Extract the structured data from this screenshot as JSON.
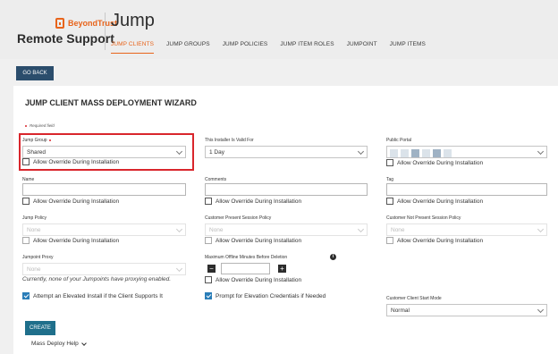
{
  "brand": {
    "logo_text": "BeyondTrust",
    "product": "Remote Support"
  },
  "page": {
    "title": "Jump"
  },
  "tabs": [
    "JUMP CLIENTS",
    "JUMP GROUPS",
    "JUMP POLICIES",
    "JUMP ITEM ROLES",
    "JUMPOINT",
    "JUMP ITEMS"
  ],
  "active_tab": "JUMP CLIENTS",
  "go_back": "GO BACK",
  "wizard": {
    "title": "JUMP CLIENT MASS DEPLOYMENT WIZARD",
    "required_note": "Required field",
    "override": "Allow Override During Installation",
    "jump_group": {
      "label": "Jump Group",
      "value": "Shared"
    },
    "valid_for": {
      "label": "This Installer Is Valid For",
      "value": "1 Day"
    },
    "public_portal": {
      "label": "Public Portal"
    },
    "name": {
      "label": "Name",
      "value": ""
    },
    "comments": {
      "label": "Comments",
      "value": ""
    },
    "tag": {
      "label": "Tag",
      "value": ""
    },
    "jump_policy": {
      "label": "Jump Policy",
      "value": "None"
    },
    "present_policy": {
      "label": "Customer Present Session Policy",
      "value": "None"
    },
    "not_present_policy": {
      "label": "Customer Not Present Session Policy",
      "value": "None"
    },
    "jumpoint_proxy": {
      "label": "Jumpoint Proxy",
      "value": "None",
      "note": "Currently, none of your Jumpoints have proxying enabled."
    },
    "max_offline": {
      "label": "Maximum Offline Minutes Before Deletion",
      "value": "",
      "minus": "−",
      "plus": "+",
      "info": "i"
    },
    "elevated": {
      "label": "Attempt an Elevated Install if the Client Supports It",
      "checked": true
    },
    "prompt_elevation": {
      "label": "Prompt for Elevation Credentials if Needed",
      "checked": true
    },
    "start_mode": {
      "label": "Customer Client Start Mode",
      "value": "Normal"
    },
    "create": "CREATE",
    "help": "Mass Deploy Help"
  },
  "colors": {
    "accent": "#e8641b",
    "go_back": "#2b4d6c",
    "create": "#1f6f8b",
    "highlight": "#d9262c",
    "checkbox": "#2a7db8"
  }
}
